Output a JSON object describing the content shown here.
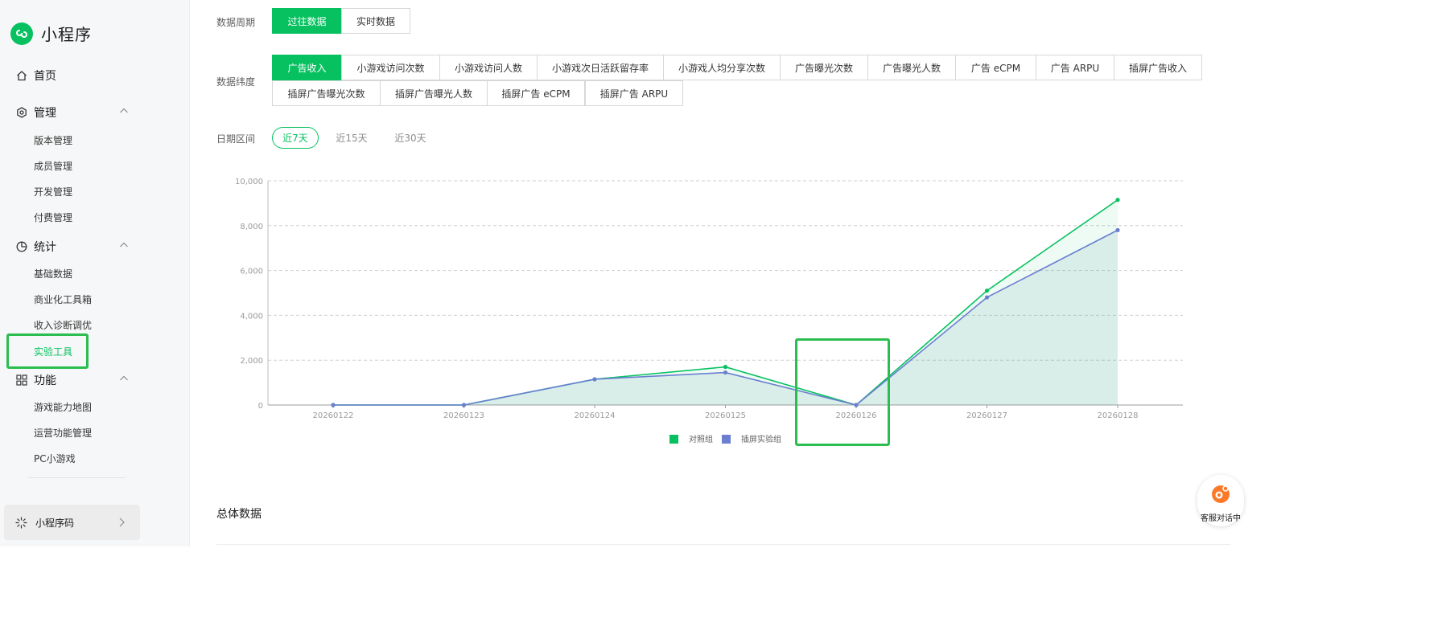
{
  "sidebar": {
    "brand": "小程序",
    "home": "首页",
    "groups": [
      {
        "label": "管理",
        "items": [
          "版本管理",
          "成员管理",
          "开发管理",
          "付费管理"
        ]
      },
      {
        "label": "统计",
        "items": [
          "基础数据",
          "商业化工具箱",
          "收入诊断调优",
          "实验工具"
        ]
      },
      {
        "label": "功能",
        "items": [
          "游戏能力地图",
          "运营功能管理",
          "PC小游戏"
        ]
      }
    ],
    "active_item": "实验工具",
    "mini_code": "小程序码"
  },
  "filters": {
    "period_label": "数据周期",
    "period_options": [
      "过往数据",
      "实时数据"
    ],
    "period_selected": "过往数据",
    "dimension_label": "数据纬度",
    "dimension_options": [
      "广告收入",
      "小游戏访问次数",
      "小游戏访问人数",
      "小游戏次日活跃留存率",
      "小游戏人均分享次数",
      "广告曝光次数",
      "广告曝光人数",
      "广告 eCPM",
      "广告 ARPU",
      "插屏广告收入",
      "插屏广告曝光次数",
      "插屏广告曝光人数",
      "插屏广告 eCPM",
      "插屏广告 ARPU"
    ],
    "dimension_selected": "广告收入",
    "range_label": "日期区间",
    "range_options": [
      "近7天",
      "近15天",
      "近30天"
    ],
    "range_selected": "近7天"
  },
  "chart_data": {
    "type": "line",
    "x": [
      "20260122",
      "20260123",
      "20260124",
      "20260125",
      "20260126",
      "20260127",
      "20260128"
    ],
    "yticks": [
      "0",
      "2,000",
      "4,000",
      "6,000",
      "8,000",
      "10,000"
    ],
    "ylim": [
      0,
      10000
    ],
    "grid": true,
    "legend_position": "bottom",
    "series": [
      {
        "name": "对照组",
        "values": [
          0,
          0,
          1150,
          1700,
          0,
          5100,
          9150
        ],
        "color": "#07c160"
      },
      {
        "name": "插屏实验组",
        "values": [
          0,
          0,
          1150,
          1450,
          0,
          4800,
          7800
        ],
        "color": "#6b7fd1"
      }
    ]
  },
  "section_title": "总体数据",
  "customer_service": "客服对话中",
  "colors": {
    "brand": "#07c160",
    "highlight": "#2bbd4e",
    "series_b": "#6b7fd1"
  }
}
